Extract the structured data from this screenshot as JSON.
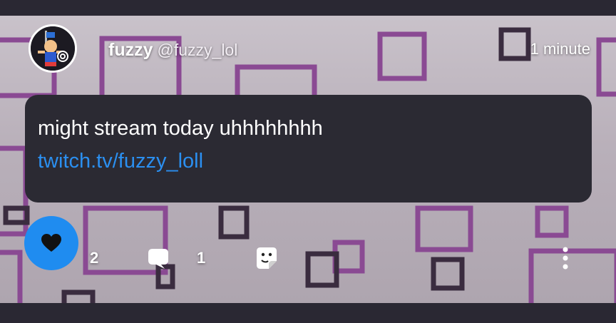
{
  "post": {
    "author": {
      "avatar": "avatar-image",
      "display_name": "fuzzy",
      "handle": "@fuzzy_lol"
    },
    "timestamp": "1 minute",
    "message": "might stream today uhhhhhhhh",
    "link": "twitch.tv/fuzzy_loll",
    "actions": {
      "like": {
        "icon": "heart-icon",
        "count": "2",
        "active": true
      },
      "comment": {
        "icon": "comment-icon",
        "count": "1"
      },
      "share": {
        "icon": "sticker-icon"
      },
      "more": {
        "icon": "more-vertical-icon"
      }
    }
  },
  "colors": {
    "accent": "#1f8cf0",
    "link": "#2b8ff0",
    "bubble": "#2b2a33",
    "frame": "#2a2833",
    "pattern_purple": "#8a4a93"
  }
}
